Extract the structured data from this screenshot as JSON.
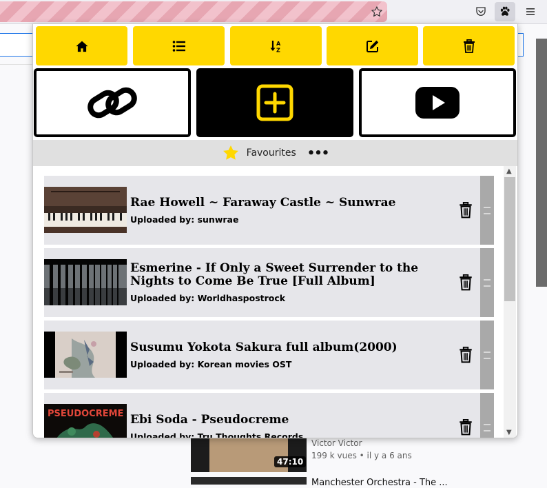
{
  "browser": {
    "bookmark_icon": "star-outline-icon",
    "toolbar_icons": [
      "pocket-icon",
      "paw-icon",
      "hamburger-menu-icon"
    ]
  },
  "popup": {
    "toolbar_buttons": [
      {
        "name": "home",
        "icon": "home-icon"
      },
      {
        "name": "list",
        "icon": "list-icon"
      },
      {
        "name": "sort",
        "icon": "sort-alpha-icon"
      },
      {
        "name": "edit",
        "icon": "edit-icon"
      },
      {
        "name": "delete",
        "icon": "trash-icon"
      }
    ],
    "action_buttons": [
      {
        "name": "link",
        "icon": "link-icon"
      },
      {
        "name": "add",
        "icon": "plus-square-icon"
      },
      {
        "name": "youtube",
        "icon": "youtube-icon"
      }
    ],
    "playlist": {
      "label": "Favourites",
      "more": "•••"
    },
    "videos": [
      {
        "title": "Rae Howell ~ Faraway Castle ~ Sunwrae",
        "uploader": "Uploaded by: sunwrae"
      },
      {
        "title": "Esmerine - If Only a Sweet Surrender to the Nights to Come Be True [Full Album]",
        "uploader": "Uploaded by: Worldhaspostrock"
      },
      {
        "title": "Susumu Yokota Sakura full album(2000)",
        "uploader": "Uploaded by: Korean movies OST"
      },
      {
        "title": "Ebi Soda - Pseudocreme",
        "uploader": "Uploaded by: Tru Thoughts Records"
      }
    ],
    "thumb_text": {
      "v4": "PSEUDOCREME"
    }
  },
  "background": {
    "duration": "47:10",
    "channel": "Victor Victor",
    "meta": "199 k vues • il y a 6 ans",
    "next_title": "Manchester Orchestra - The ..."
  },
  "colors": {
    "accent": "#ffd800",
    "chrome": "#f0f0f4",
    "card": "#e6e6ea"
  }
}
